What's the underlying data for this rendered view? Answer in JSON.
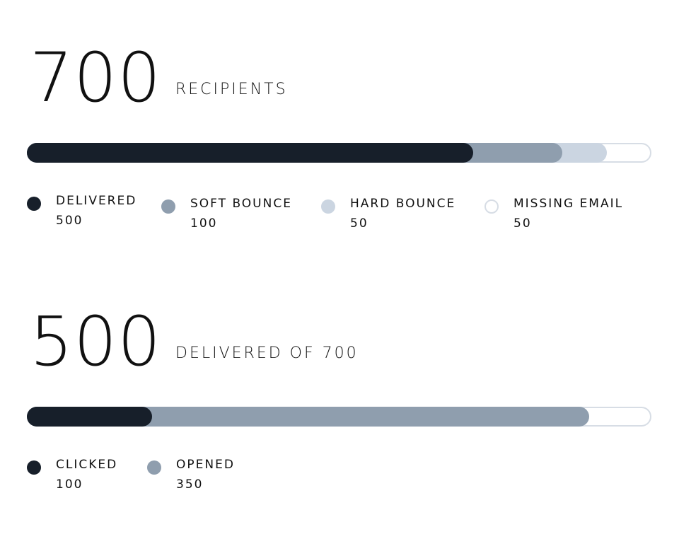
{
  "colors": {
    "dark": "#171f2a",
    "medium": "#8f9eae",
    "light": "#cbd5e1",
    "empty": "#ffffff",
    "border": "#d7dde5"
  },
  "recipients": {
    "total": "700",
    "caption": "RECIPIENTS",
    "total_value": 700,
    "legend": [
      {
        "label": "DELIVERED",
        "value": "500",
        "amount": 500,
        "color": "#171f2a"
      },
      {
        "label": "SOFT BOUNCE",
        "value": "100",
        "amount": 100,
        "color": "#8f9eae"
      },
      {
        "label": "HARD BOUNCE",
        "value": "50",
        "amount": 50,
        "color": "#cbd5e1"
      },
      {
        "label": "MISSING EMAIL",
        "value": "50",
        "amount": 50,
        "color": "#ffffff"
      }
    ]
  },
  "delivered": {
    "total": "500",
    "caption": "DELIVERED OF 700",
    "total_value": 500,
    "legend": [
      {
        "label": "CLICKED",
        "value": "100",
        "amount": 100,
        "color": "#171f2a"
      },
      {
        "label": "OPENED",
        "value": "350",
        "amount": 350,
        "color": "#8f9eae"
      }
    ]
  }
}
